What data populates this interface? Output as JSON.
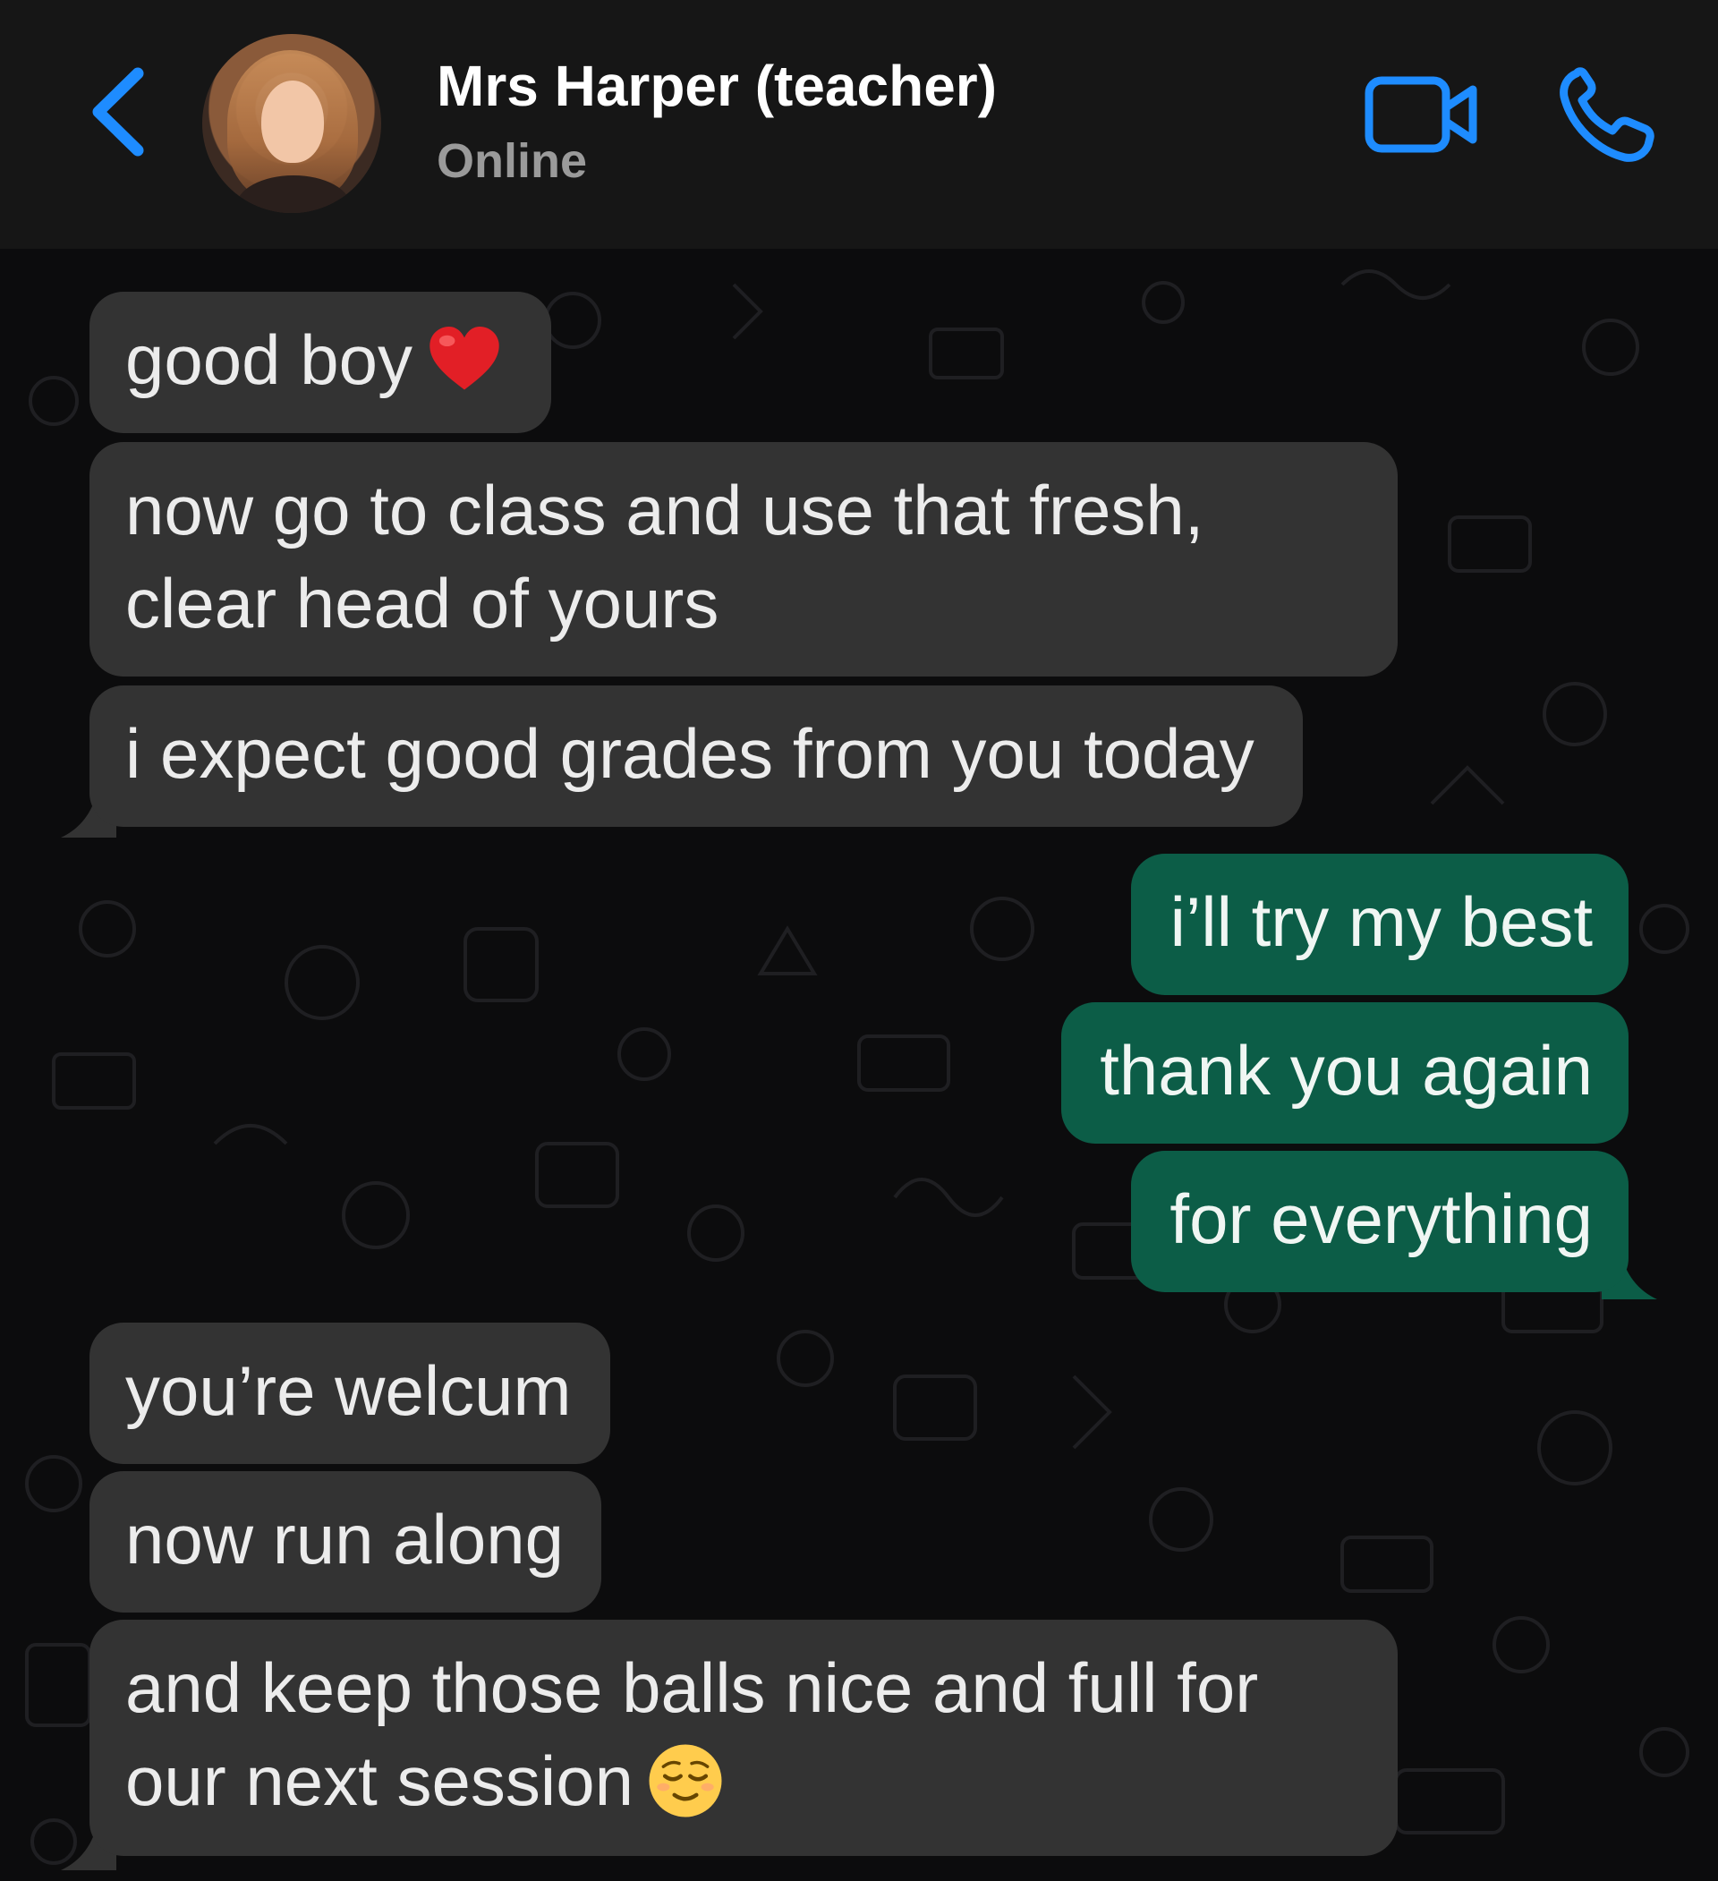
{
  "header": {
    "back_icon": "chevron-left-icon",
    "contact_name": "Mrs Harper (teacher)",
    "status": "Online",
    "video_icon": "video-camera-icon",
    "call_icon": "phone-icon",
    "accent": "#1e8cff"
  },
  "messages": [
    {
      "from": "contact",
      "text": "good boy",
      "emoji": "red-heart-icon"
    },
    {
      "from": "contact",
      "text": "now go to class and use that fresh, clear head of yours"
    },
    {
      "from": "contact",
      "text": "i expect good grades from you today"
    },
    {
      "from": "me",
      "text": "i’ll try my best"
    },
    {
      "from": "me",
      "text": "thank you again"
    },
    {
      "from": "me",
      "text": "for everything"
    },
    {
      "from": "contact",
      "text": "you’re welcum"
    },
    {
      "from": "contact",
      "text": "now run along"
    },
    {
      "from": "contact",
      "text": "and keep those balls nice and full for our next session",
      "emoji": "relieved-face-icon"
    }
  ],
  "colors": {
    "incoming_bubble": "#333333",
    "outgoing_bubble": "#0c5d47",
    "header_bg": "#161616",
    "chat_bg": "#0c0c0d"
  }
}
